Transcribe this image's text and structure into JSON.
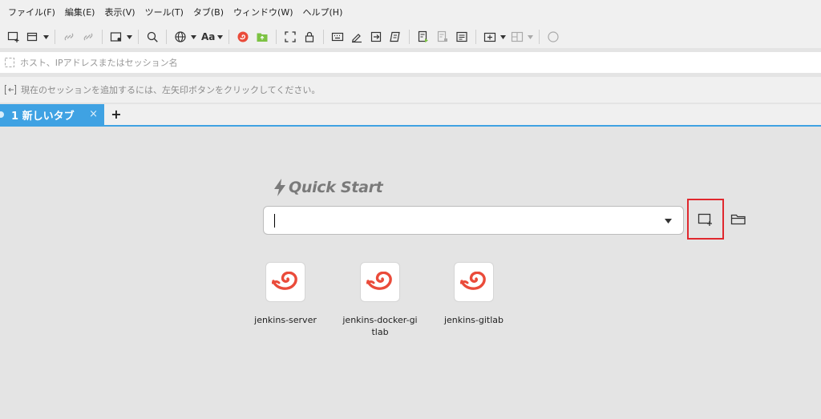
{
  "menu": [
    "ファイル(F)",
    "編集(E)",
    "表示(V)",
    "ツール(T)",
    "タブ(B)",
    "ウィンドウ(W)",
    "ヘルプ(H)"
  ],
  "toolbar": {
    "font_label": "Aa"
  },
  "address": {
    "placeholder": "ホスト、IPアドレスまたはセッション名"
  },
  "hint": {
    "text": "現在のセッションを追加するには、左矢印ボタンをクリックしてください。"
  },
  "tabs": [
    {
      "label": "1 新しいタブ"
    }
  ],
  "tab_close": "×",
  "tab_add": "+",
  "quickstart": {
    "title": "Quick Start",
    "input_value": ""
  },
  "sessions": [
    {
      "name": "jenkins-server"
    },
    {
      "name": "jenkins-docker-gitlab"
    },
    {
      "name": "jenkins-gitlab"
    }
  ],
  "colors": {
    "accent": "#3fa2e3",
    "brand": "#ea4b3a",
    "highlight": "#e0282e",
    "green": "#7cc243"
  }
}
